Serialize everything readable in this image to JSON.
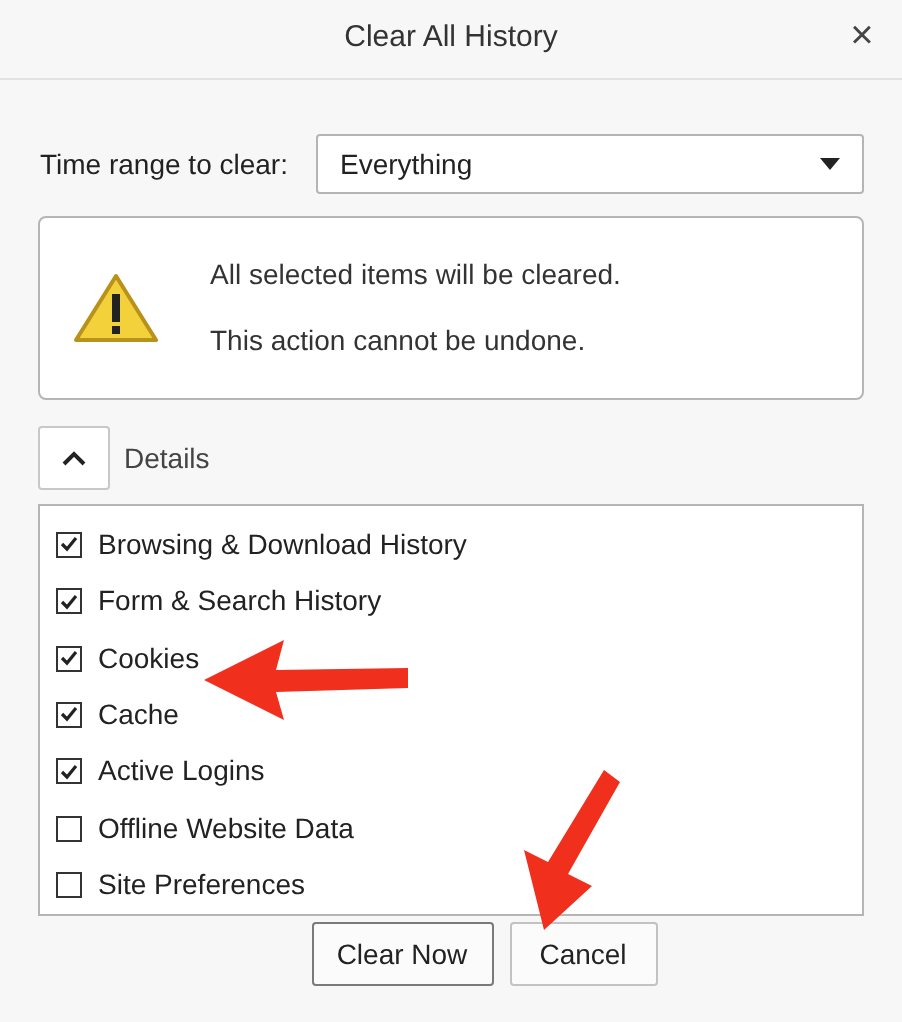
{
  "window": {
    "title": "Clear All History",
    "close": "×"
  },
  "time_range": {
    "label": "Time range to clear:",
    "value": "Everything"
  },
  "warning": {
    "lines": [
      "All selected items will be cleared.",
      "This action cannot be undone."
    ]
  },
  "details": {
    "label": "Details",
    "expanded": true
  },
  "items": [
    {
      "label": "Browsing & Download History",
      "checked": true
    },
    {
      "label": "Form & Search History",
      "checked": true
    },
    {
      "label": "Cookies",
      "checked": true
    },
    {
      "label": "Cache",
      "checked": true
    },
    {
      "label": "Active Logins",
      "checked": true
    },
    {
      "label": "Offline Website Data",
      "checked": false
    },
    {
      "label": "Site Preferences",
      "checked": false
    }
  ],
  "buttons": [
    {
      "label": "Clear Now",
      "default": true
    },
    {
      "label": "Cancel",
      "default": false
    }
  ]
}
